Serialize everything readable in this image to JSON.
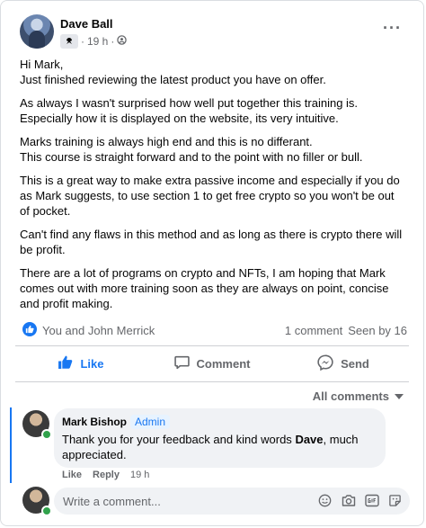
{
  "post": {
    "author": "Dave Ball",
    "time": "19 h",
    "separator": "·",
    "more": "···",
    "paragraphs": [
      "Hi Mark,\nJust finished  reviewing the latest product you have on offer.",
      "As always I wasn't surprised how well put  together this training is.\nEspecially how it is displayed on the website, its very intuitive.",
      "Marks training is always high end and this is no differant.\nThis course is straight forward and to the point with no filler or bull.",
      "This is a great way to make extra passive income and especially if you do as Mark suggests, to use section 1 to get  free crypto so you won't be out of pocket.",
      "Can't find any flaws in this method and as long as there is crypto there will be profit.",
      "There are a lot of programs on crypto and NFTs, I am hoping that Mark comes out with more training soon as they are always on point, concise and profit making."
    ]
  },
  "summary": {
    "reactors": "You and John Merrick",
    "comments": "1 comment",
    "seen": "Seen by 16"
  },
  "actions": {
    "like": "Like",
    "comment": "Comment",
    "send": "Send"
  },
  "all_comments": "All comments",
  "comment": {
    "author": "Mark Bishop",
    "badge": "Admin",
    "text_before": "Thank you for your feedback and kind words ",
    "text_bold": "Dave",
    "text_after": ", much appreciated.",
    "like": "Like",
    "reply": "Reply",
    "time": "19 h"
  },
  "write": {
    "placeholder": "Write a comment..."
  },
  "colors": {
    "accent": "#1877f2",
    "muted": "#65676b",
    "bubble": "#f0f2f5",
    "online": "#31a24c"
  }
}
